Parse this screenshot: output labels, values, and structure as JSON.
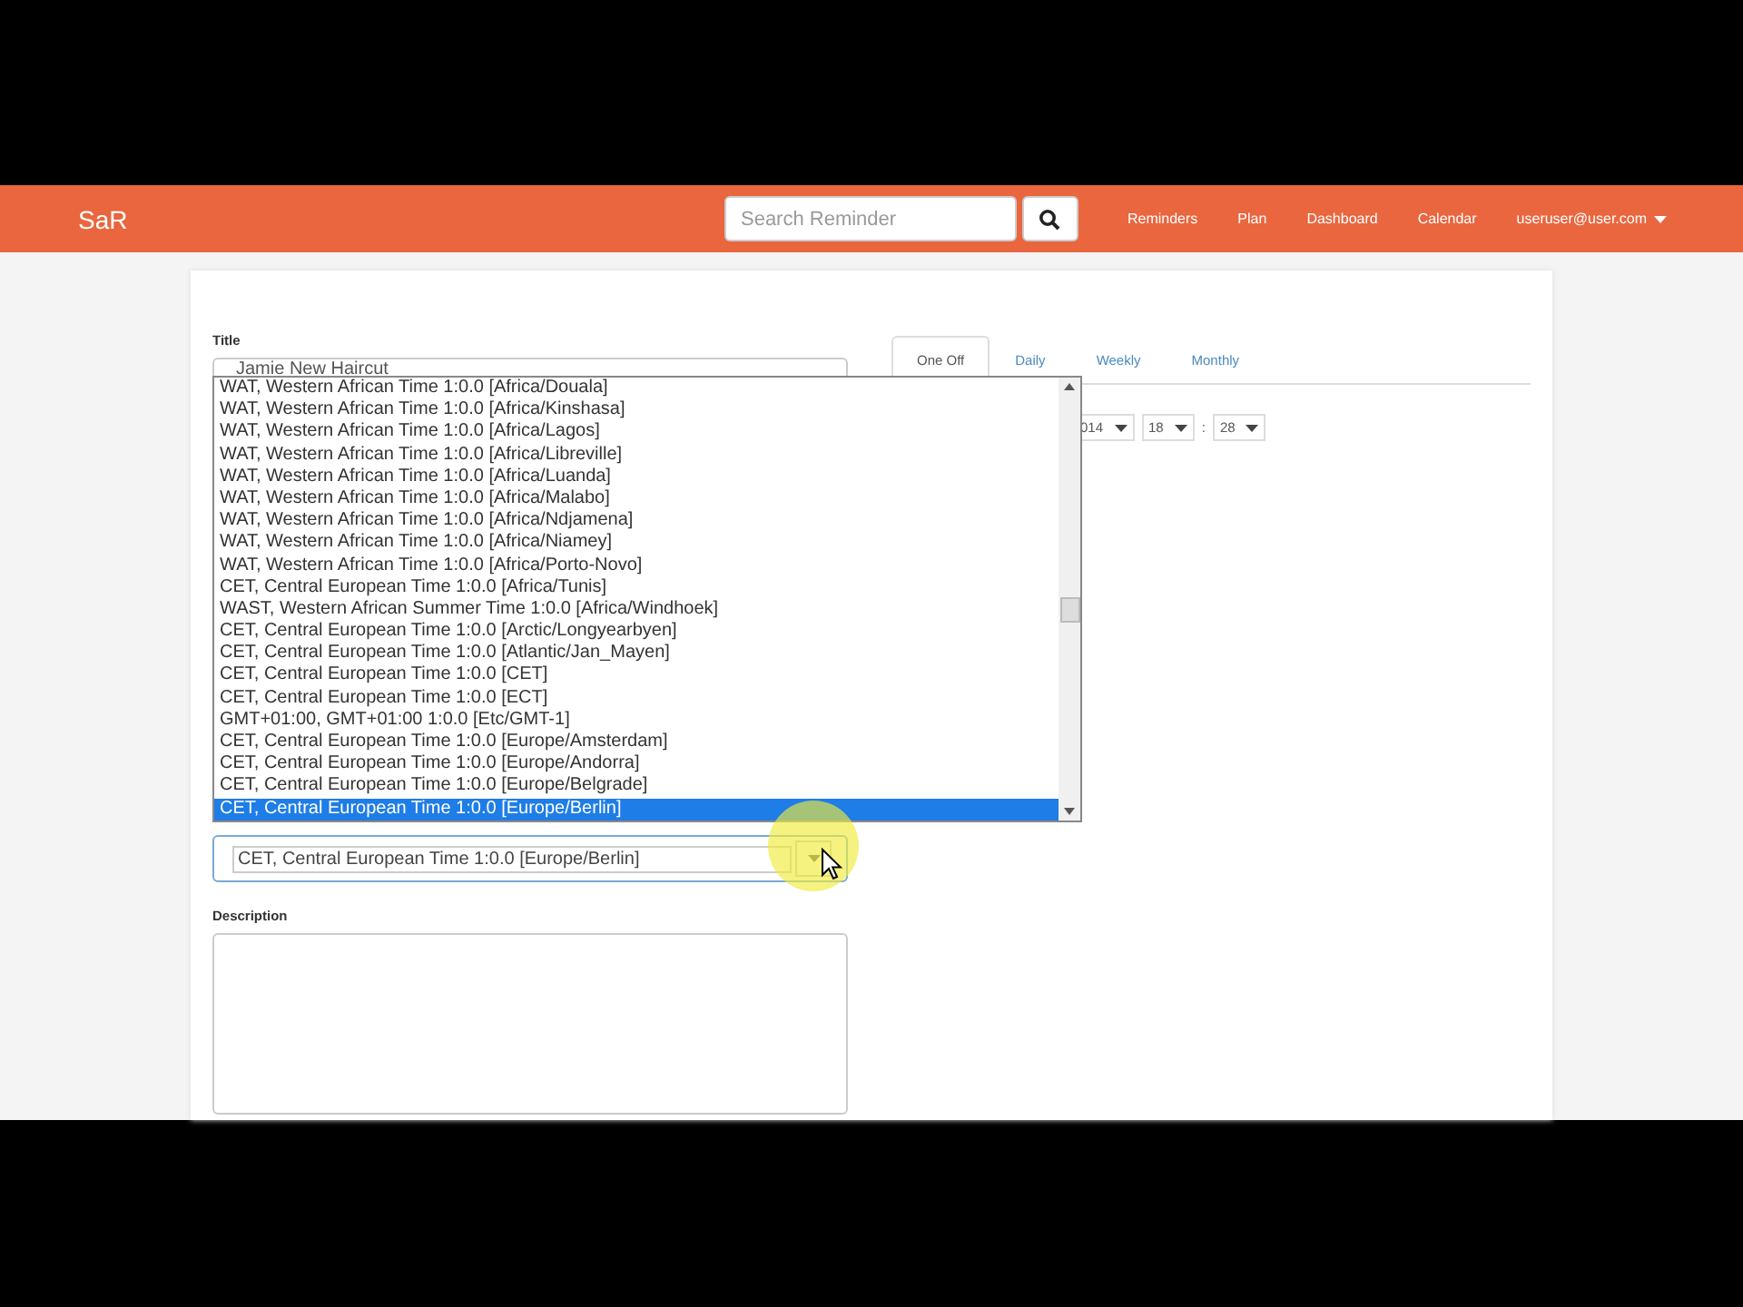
{
  "navbar": {
    "brand": "SaR",
    "search": {
      "placeholder": "Search Reminder"
    },
    "links": [
      {
        "label": "Reminders"
      },
      {
        "label": "Plan"
      },
      {
        "label": "Dashboard"
      },
      {
        "label": "Calendar"
      }
    ],
    "user": "useruser@user.com"
  },
  "form": {
    "title": {
      "label": "Title",
      "value": "Jamie New Haircut"
    },
    "timezone_list": [
      {
        "label": "WAT, Western African Time 1:0.0 [Africa/Douala]",
        "selected": false
      },
      {
        "label": "WAT, Western African Time 1:0.0 [Africa/Kinshasa]",
        "selected": false
      },
      {
        "label": "WAT, Western African Time 1:0.0 [Africa/Lagos]",
        "selected": false
      },
      {
        "label": "WAT, Western African Time 1:0.0 [Africa/Libreville]",
        "selected": false
      },
      {
        "label": "WAT, Western African Time 1:0.0 [Africa/Luanda]",
        "selected": false
      },
      {
        "label": "WAT, Western African Time 1:0.0 [Africa/Malabo]",
        "selected": false
      },
      {
        "label": "WAT, Western African Time 1:0.0 [Africa/Ndjamena]",
        "selected": false
      },
      {
        "label": "WAT, Western African Time 1:0.0 [Africa/Niamey]",
        "selected": false
      },
      {
        "label": "WAT, Western African Time 1:0.0 [Africa/Porto-Novo]",
        "selected": false
      },
      {
        "label": "CET, Central European Time 1:0.0 [Africa/Tunis]",
        "selected": false
      },
      {
        "label": "WAST, Western African Summer Time 1:0.0 [Africa/Windhoek]",
        "selected": false
      },
      {
        "label": "CET, Central European Time 1:0.0 [Arctic/Longyearbyen]",
        "selected": false
      },
      {
        "label": "CET, Central European Time 1:0.0 [Atlantic/Jan_Mayen]",
        "selected": false
      },
      {
        "label": "CET, Central European Time 1:0.0 [CET]",
        "selected": false
      },
      {
        "label": "CET, Central European Time 1:0.0 [ECT]",
        "selected": false
      },
      {
        "label": "GMT+01:00, GMT+01:00 1:0.0 [Etc/GMT-1]",
        "selected": false
      },
      {
        "label": "CET, Central European Time 1:0.0 [Europe/Amsterdam]",
        "selected": false
      },
      {
        "label": "CET, Central European Time 1:0.0 [Europe/Andorra]",
        "selected": false
      },
      {
        "label": "CET, Central European Time 1:0.0 [Europe/Belgrade]",
        "selected": false
      },
      {
        "label": "CET, Central European Time 1:0.0 [Europe/Berlin]",
        "selected": true
      }
    ],
    "timezone": {
      "value": "CET, Central European Time 1:0.0 [Europe/Berlin]"
    },
    "description": {
      "label": "Description"
    }
  },
  "schedule": {
    "tabs": [
      {
        "label": "One Off",
        "selected": true
      },
      {
        "label": "Daily",
        "selected": false
      },
      {
        "label": "Weekly",
        "selected": false
      },
      {
        "label": "Monthly",
        "selected": false
      }
    ],
    "time_selects": [
      {
        "value": "014"
      },
      {
        "value": "18"
      },
      {
        "value": "28"
      }
    ],
    "separator": ":"
  }
}
